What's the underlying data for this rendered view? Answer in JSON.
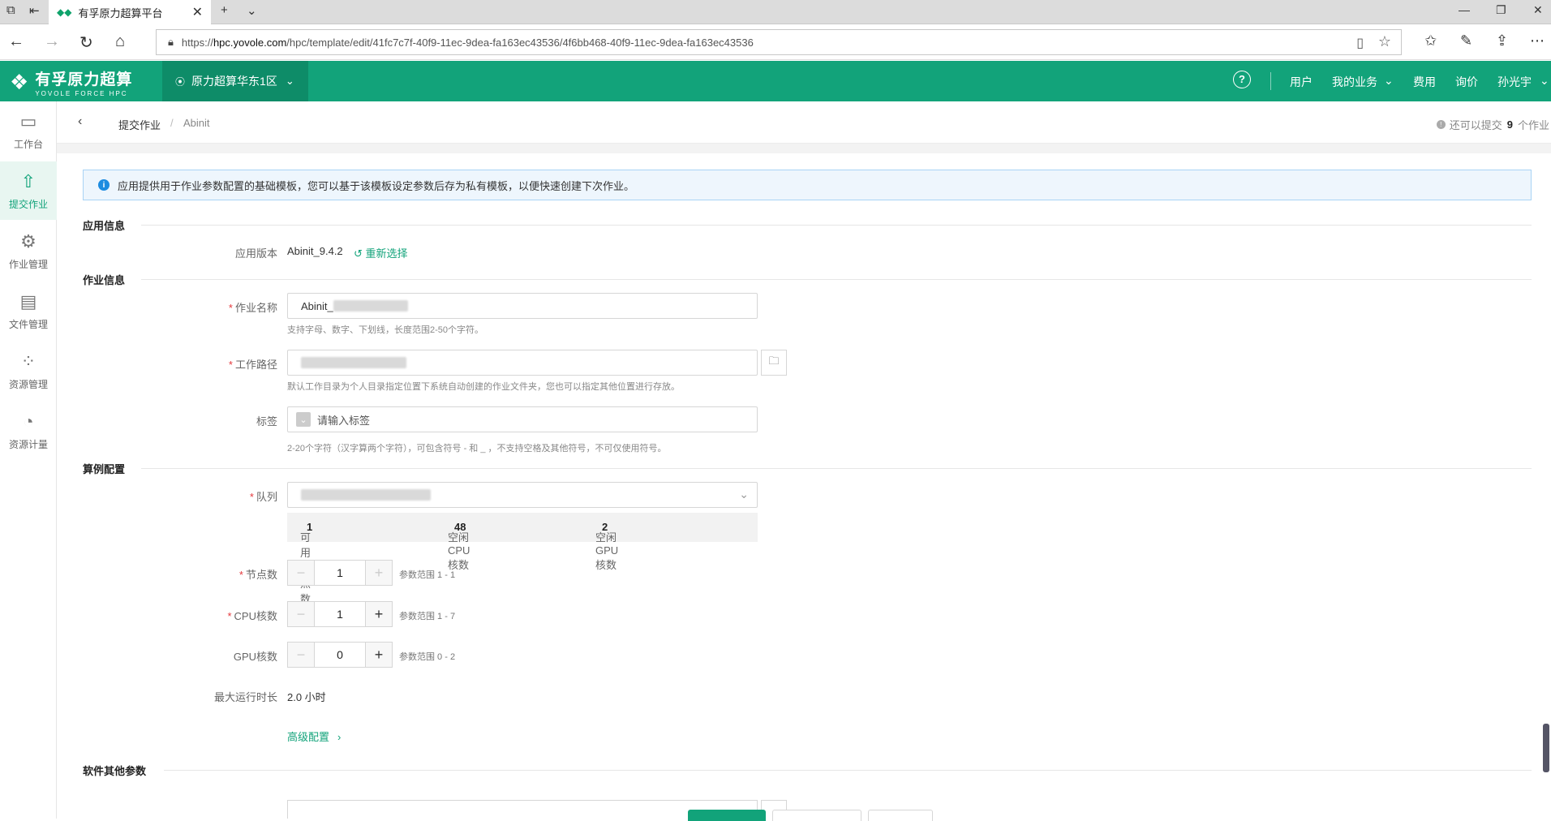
{
  "browser": {
    "tab_title": "有孚原力超算平台",
    "url_prefix": "https://",
    "url_host": "hpc.yovole.com",
    "url_path": "/hpc/template/edit/41fc7c7f-40f9-11ec-9dea-fa163ec43536/4f6bb468-40f9-11ec-9dea-fa163ec43536"
  },
  "header": {
    "logo_cn": "有孚原力超算",
    "logo_en": "YOVOLE FORCE HPC",
    "region": "原力超算华东1区",
    "nav_user": "用户",
    "nav_business": "我的业务",
    "nav_fee": "费用",
    "nav_inquiry": "询价",
    "nav_username": "孙光宇"
  },
  "sidebar": {
    "items": [
      {
        "label": "工作台"
      },
      {
        "label": "提交作业"
      },
      {
        "label": "作业管理"
      },
      {
        "label": "文件管理"
      },
      {
        "label": "资源管理"
      },
      {
        "label": "资源计量"
      }
    ]
  },
  "breadcrumb": {
    "parent": "提交作业",
    "separator": "/",
    "current": "Abinit",
    "quota_prefix": "还可以提交",
    "quota_count": "9",
    "quota_suffix": "个作业"
  },
  "notice": "应用提供用于作业参数配置的基础模板，您可以基于该模板设定参数后存为私有模板，以便快速创建下次作业。",
  "app_info": {
    "section_title": "应用信息",
    "version_label": "应用版本",
    "version_value": "Abinit_9.4.2",
    "reselect": "重新选择"
  },
  "job_info": {
    "section_title": "作业信息",
    "name_label": "作业名称",
    "name_value": "Abinit_",
    "name_hint": "支持字母、数字、下划线，长度范围2-50个字符。",
    "path_label": "工作路径",
    "path_hint": "默认工作目录为个人目录指定位置下系统自动创建的作业文件夹，您也可以指定其他位置进行存放。",
    "tag_label": "标签",
    "tag_placeholder": "请输入标签",
    "tag_hint": "2-20个字符（汉字算两个字符），可包含符号 - 和 _ ，不支持空格及其他符号，不可仅使用符号。"
  },
  "compute": {
    "section_title": "算例配置",
    "queue_label": "队列",
    "free_nodes_label": "可用节点数",
    "free_nodes": "1",
    "free_cpu_label": "空闲CPU核数",
    "free_cpu": "48",
    "free_gpu_label": "空闲GPU核数",
    "free_gpu": "2",
    "nodes_label": "节点数",
    "nodes_value": "1",
    "nodes_range": "参数范围 1 - 1",
    "cpu_label": "CPU核数",
    "cpu_value": "1",
    "cpu_range": "参数范围 1 - 7",
    "gpu_label": "GPU核数",
    "gpu_value": "0",
    "gpu_range": "参数范围 0 - 2",
    "maxtime_label": "最大运行时长",
    "maxtime_value": "2.0 小时",
    "advanced": "高级配置"
  },
  "software": {
    "section_title": "软件其他参数"
  }
}
